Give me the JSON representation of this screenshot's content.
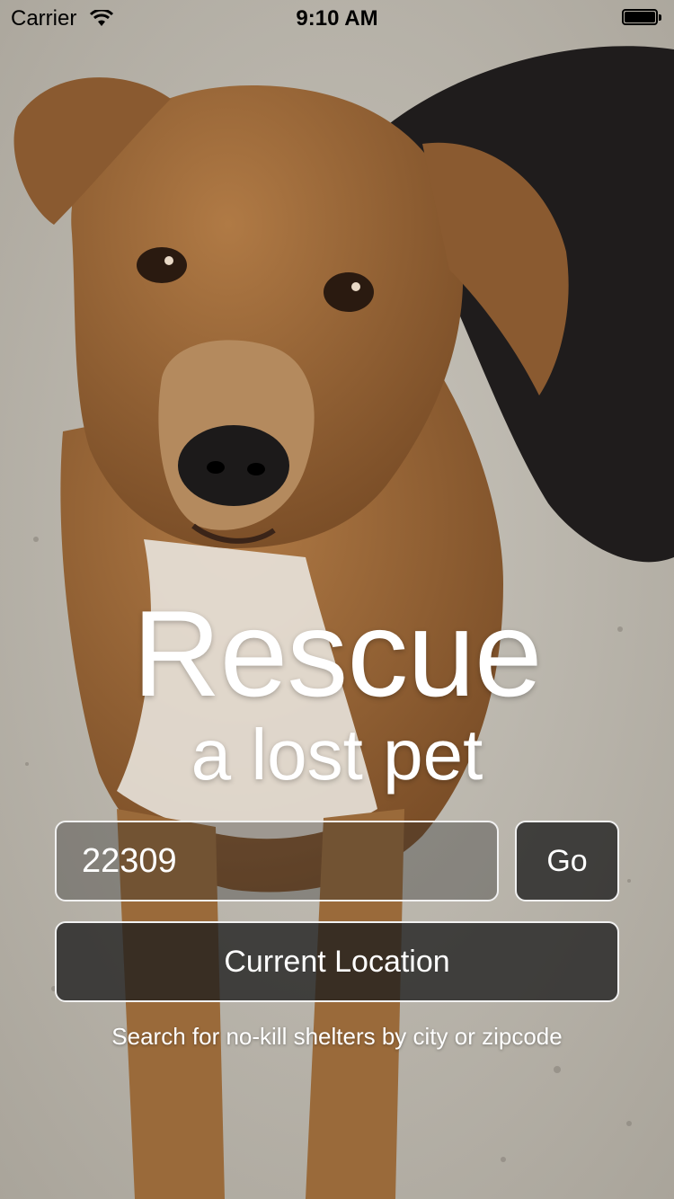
{
  "status_bar": {
    "carrier": "Carrier",
    "time": "9:10 AM",
    "wifi_icon": "wifi-icon",
    "battery_icon": "battery-icon"
  },
  "hero": {
    "image": "dog-photo",
    "title": "Rescue",
    "subtitle": "a lost pet"
  },
  "search": {
    "value": "22309",
    "go_label": "Go",
    "location_label": "Current Location",
    "hint": "Search for no-kill shelters by city or zipcode"
  },
  "colors": {
    "text": "#ffffff",
    "button_fill": "#2a2a2a",
    "border": "#f1f1f1"
  }
}
